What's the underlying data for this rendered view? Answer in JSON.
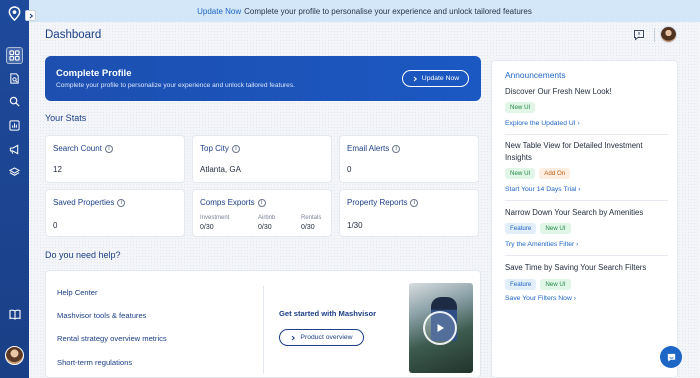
{
  "banner": {
    "link": "Update Now",
    "text": "Complete your profile to personalise your experience and unlock tailored features"
  },
  "header": {
    "title": "Dashboard"
  },
  "profile": {
    "title": "Complete Profile",
    "subtitle": "Complete your profile to personalize your experience and unlock tailored features.",
    "button": "Update Now"
  },
  "stats": {
    "title": "Your Stats",
    "search_count": {
      "label": "Search Count",
      "value": "12"
    },
    "top_city": {
      "label": "Top City",
      "value": "Atlanta, GA"
    },
    "email_alerts": {
      "label": "Email Alerts",
      "value": "0"
    },
    "saved_properties": {
      "label": "Saved Properties",
      "value": "0"
    },
    "comps_exports": {
      "label": "Comps Exports",
      "columns": [
        {
          "name": "Investment",
          "value": "0/30"
        },
        {
          "name": "Airbnb",
          "value": "0/30"
        },
        {
          "name": "Rentals",
          "value": "0/30"
        }
      ]
    },
    "property_reports": {
      "label": "Property Reports",
      "value": "1/30"
    }
  },
  "help": {
    "title": "Do you need help?",
    "links": [
      "Help Center",
      "Mashvisor tools & features",
      "Rental strategy overview metrics",
      "Short-term regulations"
    ],
    "get_started": "Get started with Mashvisor",
    "button": "Product overview"
  },
  "announcements": {
    "title": "Announcements",
    "items": [
      {
        "title": "Discover Our Fresh New Look!",
        "tags": [
          "New UI"
        ],
        "link": "Explore the Updated UI"
      },
      {
        "title": "New Table View for Detailed Investment Insights",
        "tags": [
          "New UI",
          "Add On"
        ],
        "link": "Start Your 14 Days Trial"
      },
      {
        "title": "Narrow Down Your Search by Amenities",
        "tags": [
          "Feature",
          "New UI"
        ],
        "link": "Try the Amenities Filter"
      },
      {
        "title": "Save Time by Saving Your Search Filters",
        "tags": [
          "Feature",
          "New UI"
        ],
        "link": "Save Your Filters Now"
      }
    ]
  },
  "colors": {
    "brand": "#1c3f86",
    "accent": "#1d66c6",
    "sidebar": "#1e4a9c",
    "tag_green": "#218a45",
    "tag_orange": "#c25d16"
  },
  "icons": {
    "sidebar": [
      "dashboard-icon",
      "reports-icon",
      "search-icon",
      "chart-icon",
      "megaphone-icon",
      "layers-icon",
      "book-icon"
    ],
    "chat": "chat-icon",
    "info": "info-icon",
    "chevron": "chevron-right-icon",
    "play": "play-icon"
  }
}
